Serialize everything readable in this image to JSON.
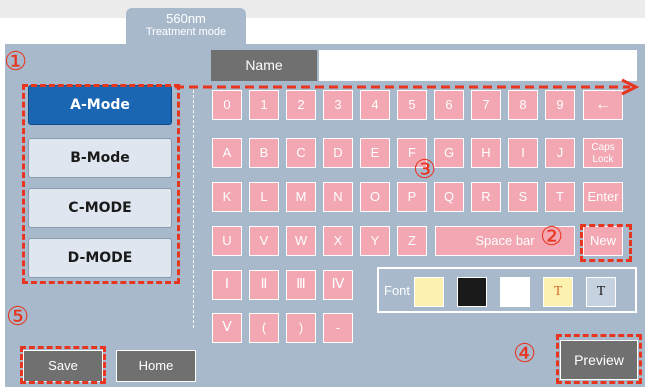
{
  "tab": {
    "line1": "560nm",
    "line2": "Treatment mode"
  },
  "name": {
    "label": "Name",
    "value": ""
  },
  "modes": [
    "A-Mode",
    "B-Mode",
    "C-MODE",
    "D-MODE"
  ],
  "active_mode": "A-Mode",
  "keyboard": {
    "row1": [
      "0",
      "1",
      "2",
      "3",
      "4",
      "5",
      "6",
      "7",
      "8",
      "9",
      "←"
    ],
    "row2": [
      "A",
      "B",
      "C",
      "D",
      "E",
      "F",
      "G",
      "H",
      "I",
      "J",
      "Caps Lock"
    ],
    "row3": [
      "K",
      "L",
      "M",
      "N",
      "O",
      "P",
      "Q",
      "R",
      "S",
      "T",
      "Enter"
    ],
    "row4": [
      "U",
      "V",
      "W",
      "X",
      "Y",
      "Z",
      "Space bar",
      "New"
    ],
    "row5": [
      "Ⅰ",
      "Ⅱ",
      "Ⅲ",
      "Ⅳ"
    ],
    "row6": [
      "Ⅴ",
      "(",
      ")",
      "-"
    ]
  },
  "font": {
    "label": "Font",
    "swatch_text": "T"
  },
  "colors": {
    "accent": "#1a66b3",
    "key": "#f2a7b2",
    "panel": "#a8b9cc",
    "callout": "#e8351f"
  },
  "buttons": {
    "save": "Save",
    "home": "Home",
    "preview": "Preview"
  },
  "callouts": [
    "①",
    "②",
    "③",
    "④",
    "⑤"
  ]
}
